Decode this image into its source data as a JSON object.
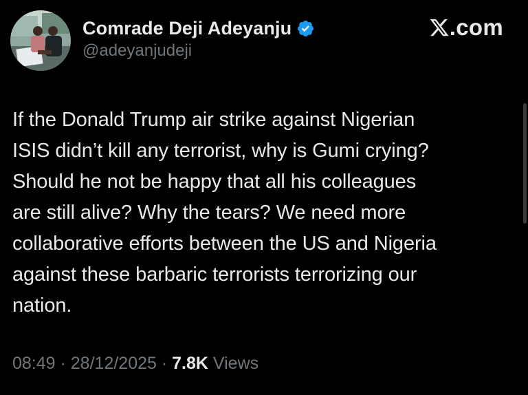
{
  "author": {
    "display_name": "Comrade Deji Adeyanju",
    "handle": "@adeyanjudeji",
    "verified_icon": "verified-badge-icon",
    "avatar_icon": "profile-photo"
  },
  "brand": {
    "domain": ".com",
    "logo_icon": "x-logo-icon"
  },
  "tweet": {
    "text": "If the Donald Trump air strike against Nigerian\nISIS didn’t kill any terrorist, why is Gumi crying?\nShould he not be happy that all his colleagues\nare still alive? Why the tears? We need more\ncollaborative efforts between the US and Nigeria\nagainst these barbaric terrorists terrorizing our\nnation.",
    "time": "08:49",
    "sep1": " · ",
    "date": "28/12/2025",
    "sep2": " · ",
    "views_count": "7.8K",
    "views_label": " Views"
  },
  "colors": {
    "background": "#000000",
    "text_primary": "#e7e9ea",
    "text_secondary": "#71767b",
    "verified_blue": "#1d9bf0"
  }
}
